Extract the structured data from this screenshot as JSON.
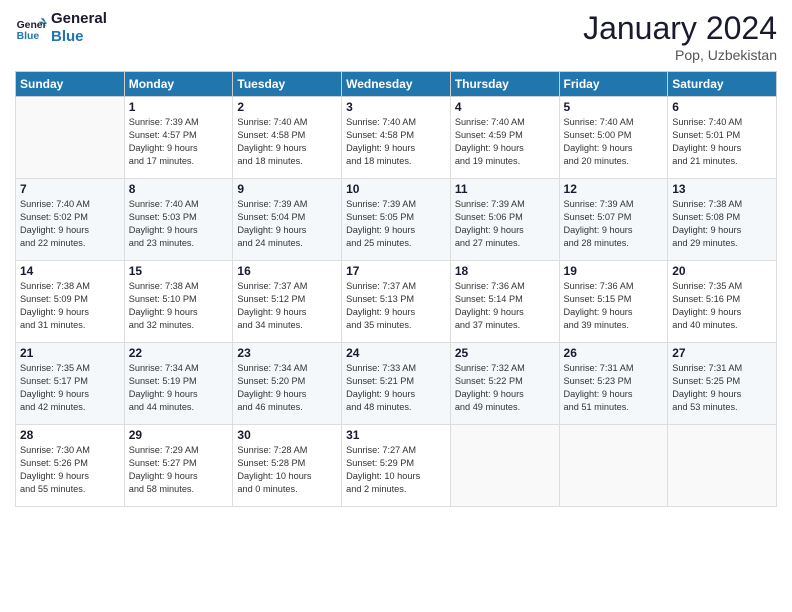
{
  "header": {
    "logo_line1": "General",
    "logo_line2": "Blue",
    "month": "January 2024",
    "location": "Pop, Uzbekistan"
  },
  "days_of_week": [
    "Sunday",
    "Monday",
    "Tuesday",
    "Wednesday",
    "Thursday",
    "Friday",
    "Saturday"
  ],
  "weeks": [
    [
      {
        "num": "",
        "text": ""
      },
      {
        "num": "1",
        "text": "Sunrise: 7:39 AM\nSunset: 4:57 PM\nDaylight: 9 hours\nand 17 minutes."
      },
      {
        "num": "2",
        "text": "Sunrise: 7:40 AM\nSunset: 4:58 PM\nDaylight: 9 hours\nand 18 minutes."
      },
      {
        "num": "3",
        "text": "Sunrise: 7:40 AM\nSunset: 4:58 PM\nDaylight: 9 hours\nand 18 minutes."
      },
      {
        "num": "4",
        "text": "Sunrise: 7:40 AM\nSunset: 4:59 PM\nDaylight: 9 hours\nand 19 minutes."
      },
      {
        "num": "5",
        "text": "Sunrise: 7:40 AM\nSunset: 5:00 PM\nDaylight: 9 hours\nand 20 minutes."
      },
      {
        "num": "6",
        "text": "Sunrise: 7:40 AM\nSunset: 5:01 PM\nDaylight: 9 hours\nand 21 minutes."
      }
    ],
    [
      {
        "num": "7",
        "text": "Sunrise: 7:40 AM\nSunset: 5:02 PM\nDaylight: 9 hours\nand 22 minutes."
      },
      {
        "num": "8",
        "text": "Sunrise: 7:40 AM\nSunset: 5:03 PM\nDaylight: 9 hours\nand 23 minutes."
      },
      {
        "num": "9",
        "text": "Sunrise: 7:39 AM\nSunset: 5:04 PM\nDaylight: 9 hours\nand 24 minutes."
      },
      {
        "num": "10",
        "text": "Sunrise: 7:39 AM\nSunset: 5:05 PM\nDaylight: 9 hours\nand 25 minutes."
      },
      {
        "num": "11",
        "text": "Sunrise: 7:39 AM\nSunset: 5:06 PM\nDaylight: 9 hours\nand 27 minutes."
      },
      {
        "num": "12",
        "text": "Sunrise: 7:39 AM\nSunset: 5:07 PM\nDaylight: 9 hours\nand 28 minutes."
      },
      {
        "num": "13",
        "text": "Sunrise: 7:38 AM\nSunset: 5:08 PM\nDaylight: 9 hours\nand 29 minutes."
      }
    ],
    [
      {
        "num": "14",
        "text": "Sunrise: 7:38 AM\nSunset: 5:09 PM\nDaylight: 9 hours\nand 31 minutes."
      },
      {
        "num": "15",
        "text": "Sunrise: 7:38 AM\nSunset: 5:10 PM\nDaylight: 9 hours\nand 32 minutes."
      },
      {
        "num": "16",
        "text": "Sunrise: 7:37 AM\nSunset: 5:12 PM\nDaylight: 9 hours\nand 34 minutes."
      },
      {
        "num": "17",
        "text": "Sunrise: 7:37 AM\nSunset: 5:13 PM\nDaylight: 9 hours\nand 35 minutes."
      },
      {
        "num": "18",
        "text": "Sunrise: 7:36 AM\nSunset: 5:14 PM\nDaylight: 9 hours\nand 37 minutes."
      },
      {
        "num": "19",
        "text": "Sunrise: 7:36 AM\nSunset: 5:15 PM\nDaylight: 9 hours\nand 39 minutes."
      },
      {
        "num": "20",
        "text": "Sunrise: 7:35 AM\nSunset: 5:16 PM\nDaylight: 9 hours\nand 40 minutes."
      }
    ],
    [
      {
        "num": "21",
        "text": "Sunrise: 7:35 AM\nSunset: 5:17 PM\nDaylight: 9 hours\nand 42 minutes."
      },
      {
        "num": "22",
        "text": "Sunrise: 7:34 AM\nSunset: 5:19 PM\nDaylight: 9 hours\nand 44 minutes."
      },
      {
        "num": "23",
        "text": "Sunrise: 7:34 AM\nSunset: 5:20 PM\nDaylight: 9 hours\nand 46 minutes."
      },
      {
        "num": "24",
        "text": "Sunrise: 7:33 AM\nSunset: 5:21 PM\nDaylight: 9 hours\nand 48 minutes."
      },
      {
        "num": "25",
        "text": "Sunrise: 7:32 AM\nSunset: 5:22 PM\nDaylight: 9 hours\nand 49 minutes."
      },
      {
        "num": "26",
        "text": "Sunrise: 7:31 AM\nSunset: 5:23 PM\nDaylight: 9 hours\nand 51 minutes."
      },
      {
        "num": "27",
        "text": "Sunrise: 7:31 AM\nSunset: 5:25 PM\nDaylight: 9 hours\nand 53 minutes."
      }
    ],
    [
      {
        "num": "28",
        "text": "Sunrise: 7:30 AM\nSunset: 5:26 PM\nDaylight: 9 hours\nand 55 minutes."
      },
      {
        "num": "29",
        "text": "Sunrise: 7:29 AM\nSunset: 5:27 PM\nDaylight: 9 hours\nand 58 minutes."
      },
      {
        "num": "30",
        "text": "Sunrise: 7:28 AM\nSunset: 5:28 PM\nDaylight: 10 hours\nand 0 minutes."
      },
      {
        "num": "31",
        "text": "Sunrise: 7:27 AM\nSunset: 5:29 PM\nDaylight: 10 hours\nand 2 minutes."
      },
      {
        "num": "",
        "text": ""
      },
      {
        "num": "",
        "text": ""
      },
      {
        "num": "",
        "text": ""
      }
    ]
  ]
}
